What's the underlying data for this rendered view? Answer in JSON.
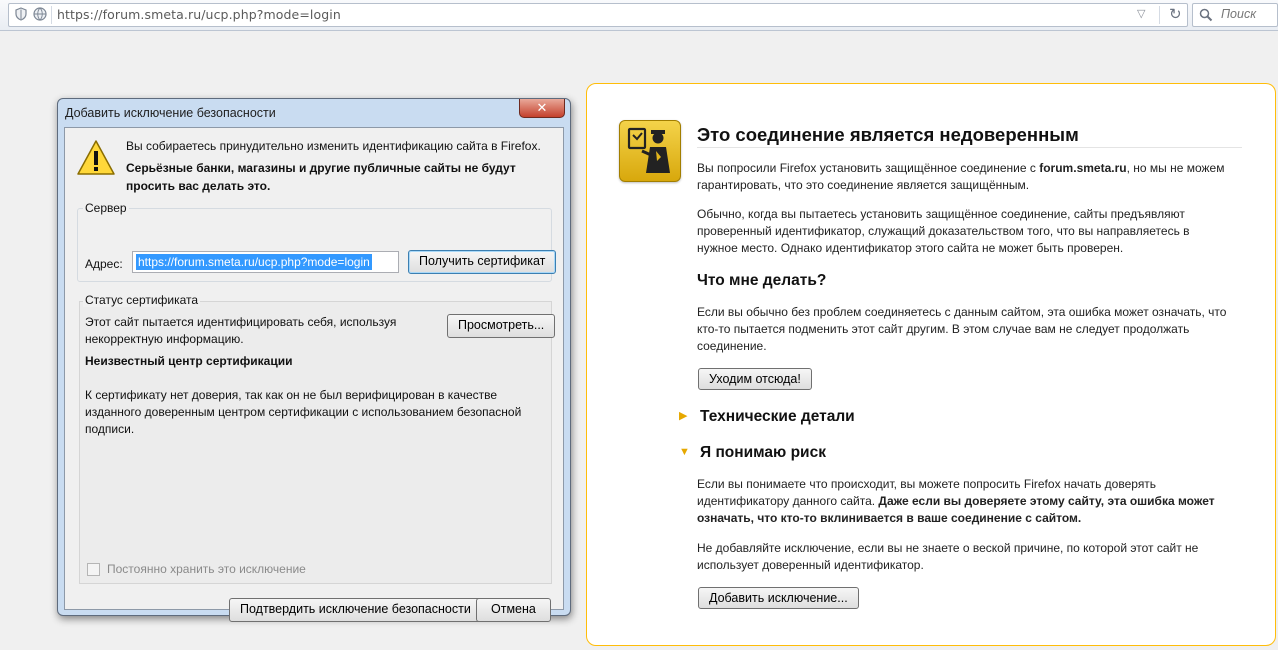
{
  "browser": {
    "url": "https://forum.smeta.ru/ucp.php?mode=login",
    "search_placeholder": "Поиск",
    "icons": [
      "shield-icon",
      "globe-icon",
      "dropdown-arrow-icon",
      "reload-icon",
      "search-icon"
    ]
  },
  "dialog": {
    "title": "Добавить исключение безопасности",
    "close_label": "✕",
    "warning_line1": "Вы собираетесь принудительно изменить идентификацию сайта в Firefox.",
    "warning_bold_line1": "Серьёзные банки, магазины и другие публичные сайты не будут",
    "warning_bold_line2": "просить вас делать это.",
    "server_group": "Сервер",
    "address_label": "Адрес:",
    "address_value": "https://forum.smeta.ru/ucp.php?mode=login",
    "get_cert_button": "Получить сертификат",
    "status_group": "Статус сертификата",
    "status_line1": "Этот сайт пытается идентифицировать себя, используя",
    "status_line2": "некорректную информацию.",
    "view_button": "Просмотреть...",
    "unknown_ca": "Неизвестный центр сертификации",
    "untrusted_line1": "К сертификату нет доверия, так как он не был верифицирован в качестве",
    "untrusted_line2": "изданного доверенным центром сертификации с использованием безопасной",
    "untrusted_line3": "подписи.",
    "permanent_label": "Постоянно хранить это исключение",
    "permanent_checked": false,
    "confirm_button": "Подтвердить исключение безопасности",
    "cancel_button": "Отмена"
  },
  "error_page": {
    "title": "Это соединение является недоверенным",
    "intro_pre": "Вы попросили Firefox установить защищённое соединение с ",
    "intro_host": "forum.smeta.ru",
    "intro_post": ", но мы не можем гарантировать, что это соединение является защищённым.",
    "p2": "Обычно, когда вы пытаетесь установить защищённое соединение, сайты предъявляют проверенный идентификатор, служащий доказательством того, что вы направляетесь в нужное место. Однако идентификатор этого сайта не может быть проверен.",
    "what_heading": "Что мне делать?",
    "p3": "Если вы обычно без проблем соединяетесь с данным сайтом, эта ошибка может означать, что кто-то пытается подменить этот сайт другим. В этом случае вам не следует продолжать соединение.",
    "leave_button": "Уходим отсюда!",
    "tech_details": "Технические детали",
    "risk_heading": "Я понимаю риск",
    "p4_pre": "Если вы понимаете что происходит, вы можете попросить Firefox начать доверять идентификатору данного сайта. ",
    "p4_bold": "Даже если вы доверяете этому сайту, эта ошибка может означать, что кто-то вклинивается в ваше соединение с сайтом.",
    "p5": "Не добавляйте исключение, если вы не знаете о веской причине, по которой этот сайт не использует доверенный идентификатор.",
    "add_exception_button": "Добавить исключение...",
    "colors": {
      "border": "#ffbd09",
      "badge": "#e2b51c"
    }
  }
}
